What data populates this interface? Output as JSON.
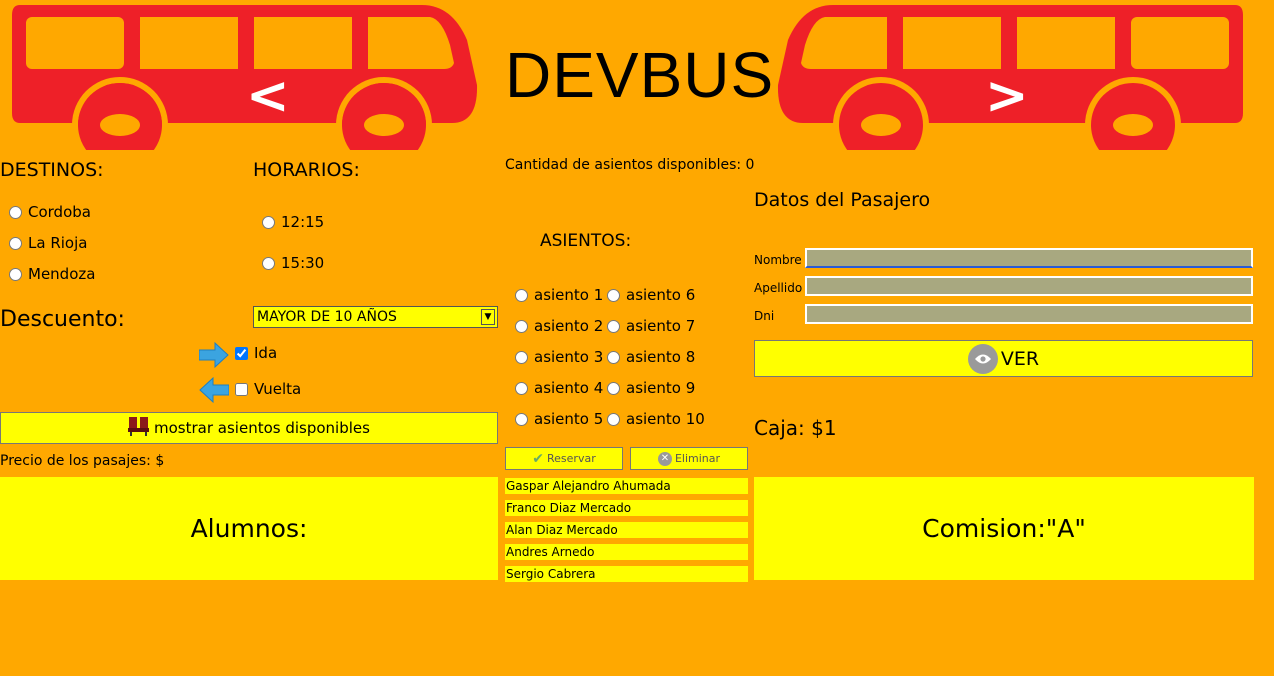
{
  "app": {
    "title": "DEVBUS",
    "bus_left_label": "<",
    "bus_right_label": ">"
  },
  "colors": {
    "background": "#FFA800",
    "bus": "#EE2028",
    "button": "#FFFF00",
    "field": "#A8A880"
  },
  "destinos": {
    "heading": "DESTINOS:",
    "options": [
      "Cordoba",
      "La Rioja",
      "Mendoza"
    ]
  },
  "horarios": {
    "heading": "HORARIOS:",
    "options": [
      "12:15",
      "15:30"
    ]
  },
  "descuento": {
    "label": "Descuento:",
    "selected": "MAYOR DE 10 AÑOS"
  },
  "trip": {
    "ida": "Ida",
    "ida_checked": true,
    "vuelta": "Vuelta",
    "vuelta_checked": false
  },
  "buttons": {
    "mostrar": "mostrar asientos disponibles",
    "reservar": "Reservar",
    "eliminar": "Eliminar",
    "ver": "VER"
  },
  "precio": {
    "label": "Precio de los pasajes:",
    "value": "$"
  },
  "asientos": {
    "available_label": "Cantidad de asientos disponibles:",
    "available_value": "0",
    "heading": "ASIENTOS:",
    "seats": [
      "asiento 1",
      "asiento 2",
      "asiento 3",
      "asiento 4",
      "asiento 5",
      "asiento 6",
      "asiento 7",
      "asiento 8",
      "asiento 9",
      "asiento 10"
    ]
  },
  "pasajero": {
    "heading": "Datos del Pasajero",
    "fields": [
      "Nombre",
      "Apellido",
      "Dni"
    ]
  },
  "caja": {
    "label": "Caja:",
    "value": "$1"
  },
  "footer": {
    "alumnos_label": "Alumnos:",
    "comision_label": "Comision:\"A\"",
    "students": [
      "Gaspar Alejandro Ahumada",
      "Franco Diaz Mercado",
      "Alan Diaz Mercado",
      "Andres Arnedo",
      "Sergio Cabrera"
    ]
  },
  "icons": [
    "bus-left-icon",
    "bus-right-icon",
    "arrow-right-icon",
    "arrow-left-icon",
    "seats-icon",
    "check-icon",
    "cancel-icon",
    "eye-icon"
  ]
}
